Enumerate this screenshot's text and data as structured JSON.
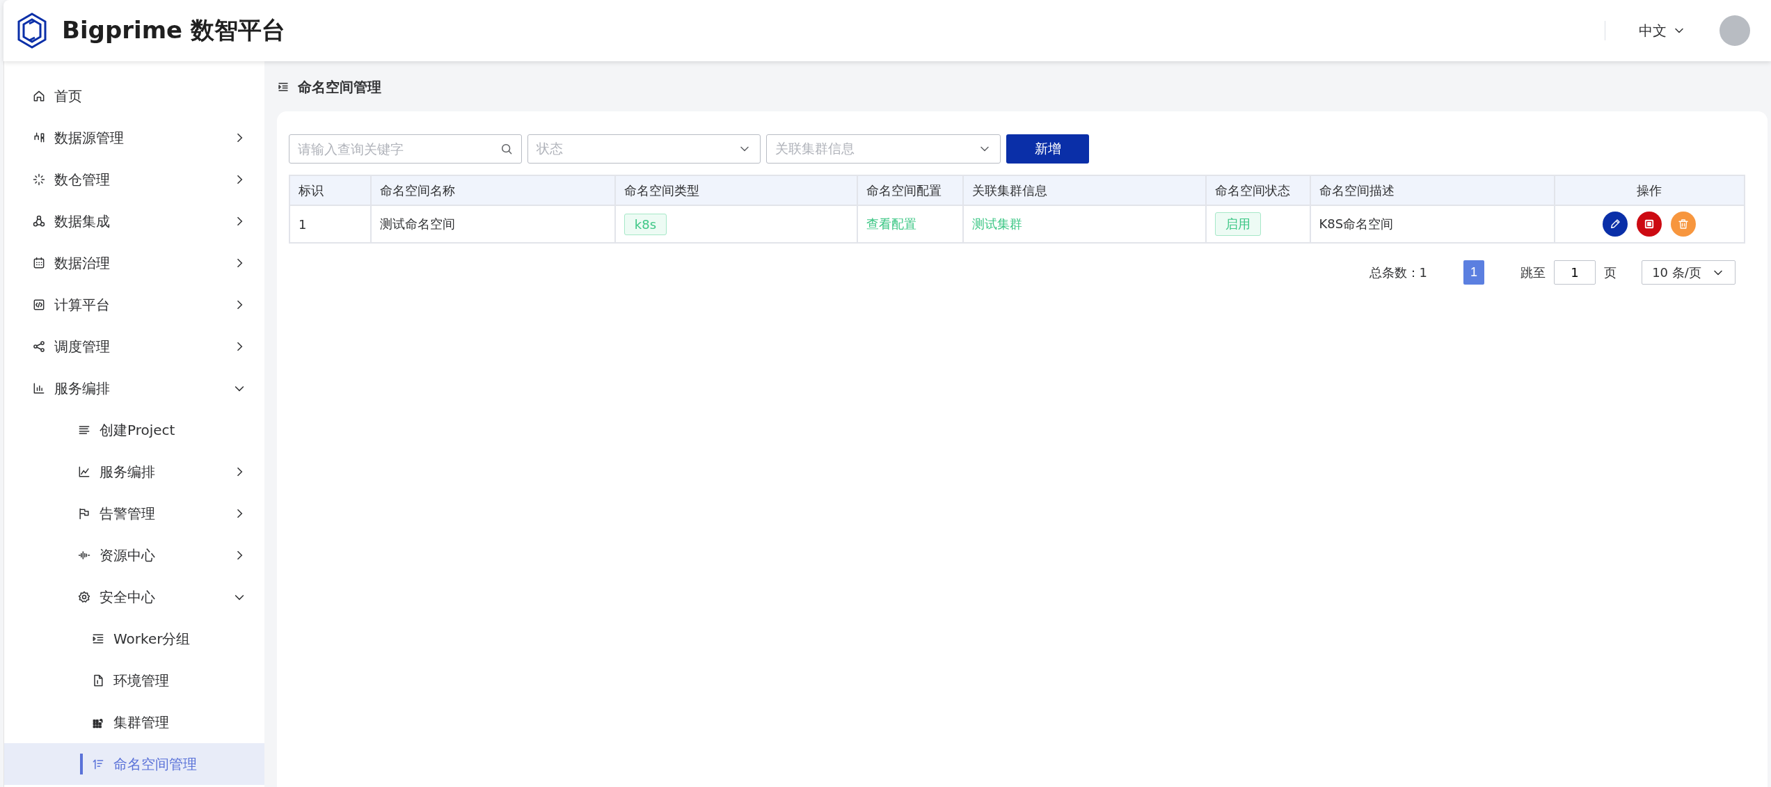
{
  "header": {
    "logo_text": "Bigprime 数智平台",
    "language": "中文"
  },
  "sidebar": {
    "items": [
      {
        "label": "首页",
        "selected": false
      },
      {
        "label": "数据源管理",
        "expanded": false,
        "selected": false
      },
      {
        "label": "数仓管理",
        "expanded": false,
        "selected": false
      },
      {
        "label": "数据集成",
        "expanded": false,
        "selected": false
      },
      {
        "label": "数据治理",
        "expanded": false,
        "selected": false
      },
      {
        "label": "计算平台",
        "expanded": false,
        "selected": false
      },
      {
        "label": "调度管理",
        "expanded": false,
        "selected": false
      },
      {
        "label": "服务编排",
        "expanded": true,
        "selected": false,
        "children": [
          {
            "label": "创建Project",
            "selected": false
          },
          {
            "label": "服务编排",
            "expanded": false,
            "selected": false
          },
          {
            "label": "告警管理",
            "expanded": false,
            "selected": false
          },
          {
            "label": "资源中心",
            "expanded": false,
            "selected": false
          },
          {
            "label": "安全中心",
            "expanded": true,
            "selected": false,
            "children": [
              {
                "label": "Worker分组",
                "selected": false
              },
              {
                "label": "环境管理",
                "selected": false
              },
              {
                "label": "集群管理",
                "selected": false
              },
              {
                "label": "命名空间管理",
                "selected": true
              }
            ]
          }
        ]
      }
    ]
  },
  "page_title": "命名空间管理",
  "toolbar": {
    "search": {
      "placeholder": "请输入查询关键字"
    },
    "status_select": {
      "placeholder": "状态"
    },
    "cluster_select": {
      "placeholder": "关联集群信息"
    },
    "add_button": "新增"
  },
  "table": {
    "columns": [
      "标识",
      "命名空间名称",
      "命名空间类型",
      "命名空间配置",
      "关联集群信息",
      "命名空间状态",
      "命名空间描述",
      "操作"
    ],
    "rows": [
      {
        "cells": [
          {
            "kind": "text",
            "text": "1"
          },
          {
            "kind": "text",
            "text": "测试命名空间"
          },
          {
            "kind": "tag",
            "text": "k8s"
          },
          {
            "kind": "link",
            "text": "查看配置"
          },
          {
            "kind": "link",
            "text": "测试集群"
          },
          {
            "kind": "tag",
            "text": "启用"
          },
          {
            "kind": "text",
            "text": "K8S命名空间"
          },
          {
            "kind": "actions"
          }
        ]
      }
    ]
  },
  "pagination": {
    "total": "总条数：1",
    "pages": [
      {
        "label": "1",
        "selected": true
      }
    ],
    "jump_label": "跳至",
    "jump_value": "1",
    "page_unit": "页",
    "page_size": "10 条/页"
  }
}
